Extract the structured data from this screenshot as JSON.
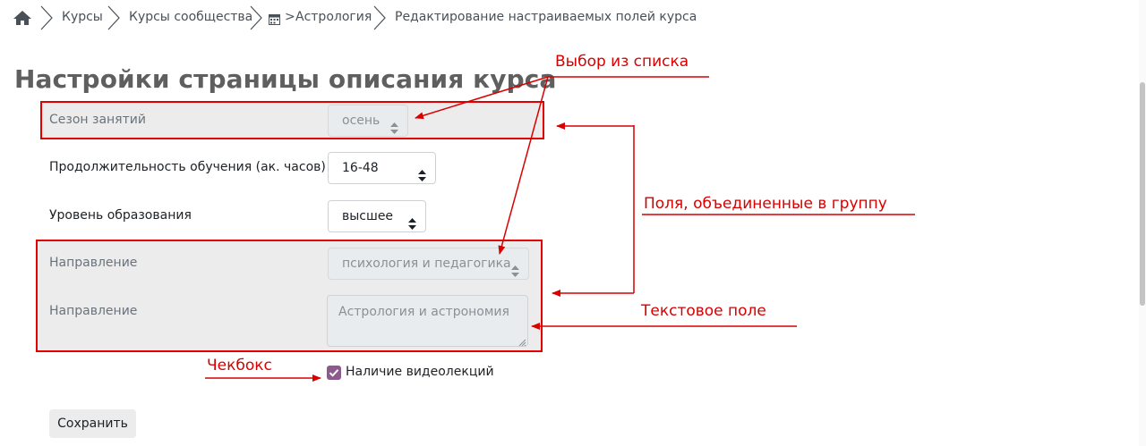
{
  "breadcrumb": {
    "items": [
      {
        "label": "Курсы"
      },
      {
        "label": "Курсы сообщества"
      },
      {
        "label": "Астрология"
      },
      {
        "label": "Редактирование настраиваемых полей курса"
      }
    ],
    "separator": ">"
  },
  "page": {
    "title": "Настройки страницы описания курса"
  },
  "form": {
    "fields": [
      {
        "label": "Сезон занятий",
        "value": "осень",
        "type": "select",
        "disabled": true
      },
      {
        "label": "Продолжительность обучения (ак. часов)",
        "value": "16-48",
        "type": "select",
        "disabled": false
      },
      {
        "label": "Уровень образования",
        "value": "высшее",
        "type": "select",
        "disabled": false
      },
      {
        "label": "Направление",
        "value": "психология и педагогика",
        "type": "select",
        "disabled": true
      },
      {
        "label": "Направление",
        "value": "Астрология и астрономия",
        "type": "textarea",
        "disabled": true
      }
    ],
    "checkbox": {
      "label": "Наличие видеолекций",
      "checked": true
    },
    "save_label": "Сохранить"
  },
  "annotations": {
    "select_list": "Выбор из списка",
    "grouped_fields": "Поля, объединенные в группу",
    "text_field": "Текстовое поле",
    "checkbox": "Чекбокс"
  },
  "colors": {
    "annotation": "#d80000",
    "checkbox_accent": "#8c5a8c",
    "group_background": "#ececec",
    "title": "#5f5f5f"
  },
  "icons": [
    "home-icon",
    "chevron-right-icon",
    "calendar-icon",
    "sort-caret-icon",
    "check-icon",
    "resize-handle-icon"
  ]
}
